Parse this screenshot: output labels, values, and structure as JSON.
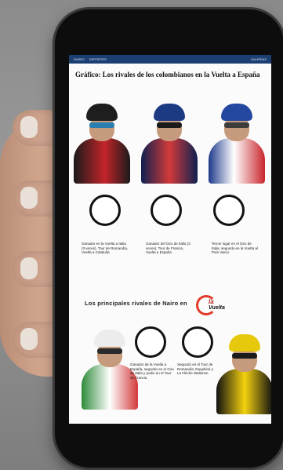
{
  "article": {
    "nav": {
      "left_items": [
        "DIARIO",
        "DEPORTES"
      ],
      "right_items": [
        "GALERÍAS"
      ]
    },
    "headline": "Gráfico: Los rivales de los colombianos en la Vuelta a España",
    "byline": "",
    "share_label": "",
    "riders_top": [
      {
        "name": "",
        "badge_label": "",
        "description": "Ganador en la Vuelta a Italia (3 veces), Tour de Romandía, Vuelta a Cataluña"
      },
      {
        "name": "",
        "badge_label": "",
        "description": "Ganador del Giro de Italia (3 veces), Tour de Francia, Vuelta a España"
      },
      {
        "name": "",
        "badge_label": "",
        "description": "Tercer lugar en el Giro de Italia, segundo en la Vuelta al País Vasco"
      }
    ],
    "section_title": "Los principales rivales de Nairo en",
    "logo_text": [
      "la",
      "Vuelta"
    ],
    "riders_bottom": [
      {
        "badge_label": "",
        "description": "Ganador de la Vuelta a España, segundo en el Giro de Italia y podio en el Tour de Francia"
      },
      {
        "badge_label": "",
        "description": "Segundo en el Tour de Romandía, Dauphiné y La Flèche Wallonne"
      }
    ]
  },
  "colors": {
    "nav_bg": "#1c3f73",
    "accent_red": "#e23a2a"
  }
}
